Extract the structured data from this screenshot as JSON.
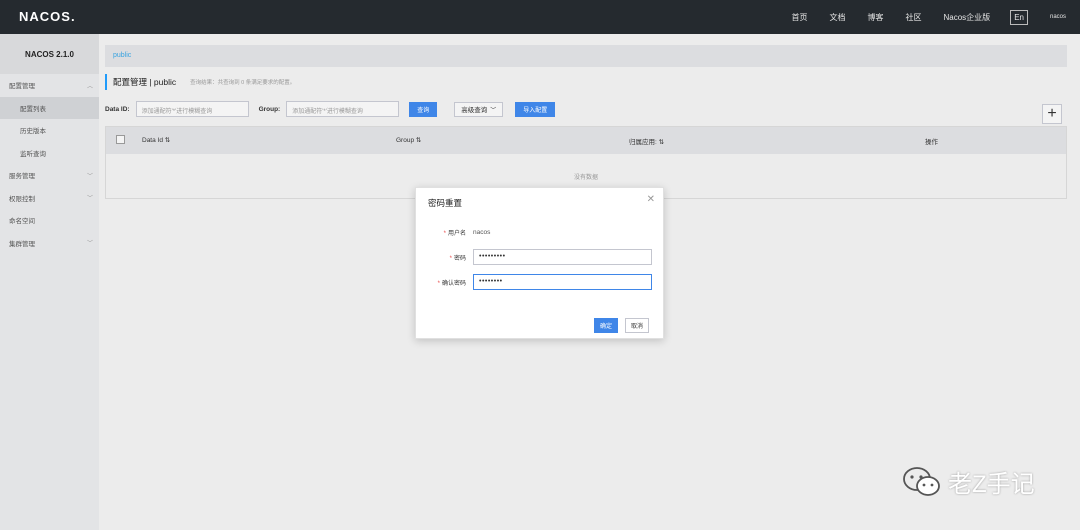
{
  "topbar": {
    "logo": "NACOS.",
    "links": [
      "首页",
      "文档",
      "博客",
      "社区",
      "Nacos企业版"
    ],
    "lang": "En",
    "user": "nacos"
  },
  "sidebar": {
    "title": "NACOS 2.1.0",
    "items": [
      {
        "label": "配置管理",
        "level": 0,
        "expanded": true
      },
      {
        "label": "配置列表",
        "level": 1,
        "active": true
      },
      {
        "label": "历史版本",
        "level": 1
      },
      {
        "label": "监听查询",
        "level": 1
      },
      {
        "label": "服务管理",
        "level": 0
      },
      {
        "label": "权限控制",
        "level": 0
      },
      {
        "label": "命名空间",
        "level": 0
      },
      {
        "label": "集群管理",
        "level": 0
      }
    ]
  },
  "main": {
    "breadcrumb": "public",
    "page_title": "配置管理 | public",
    "hint": "查询结果：共查询到 0 条满足要求的配置。",
    "filters": {
      "dataid_label": "Data ID:",
      "dataid_placeholder": "添加通配符'*'进行模糊查询",
      "group_label": "Group:",
      "group_placeholder": "添加通配符'*'进行模糊查询",
      "search_button": "查询",
      "advanced_button": "高级查询",
      "import_button": "导入配置"
    },
    "table": {
      "columns": [
        "Data Id",
        "Group",
        "归属应用:",
        "操作"
      ],
      "empty_text": "没有数据"
    }
  },
  "dialog": {
    "title": "密码重置",
    "username_label": "用户名",
    "username_value": "nacos",
    "password_label": "密码",
    "password_value": "•••••••••",
    "confirm_label": "确认密码",
    "confirm_value": "••••••••",
    "ok_button": "确定",
    "cancel_button": "取消"
  },
  "watermark": "老Z手记",
  "colors": {
    "accent": "#3f86e8",
    "topbar": "#252a2f",
    "required": "#e84545"
  }
}
